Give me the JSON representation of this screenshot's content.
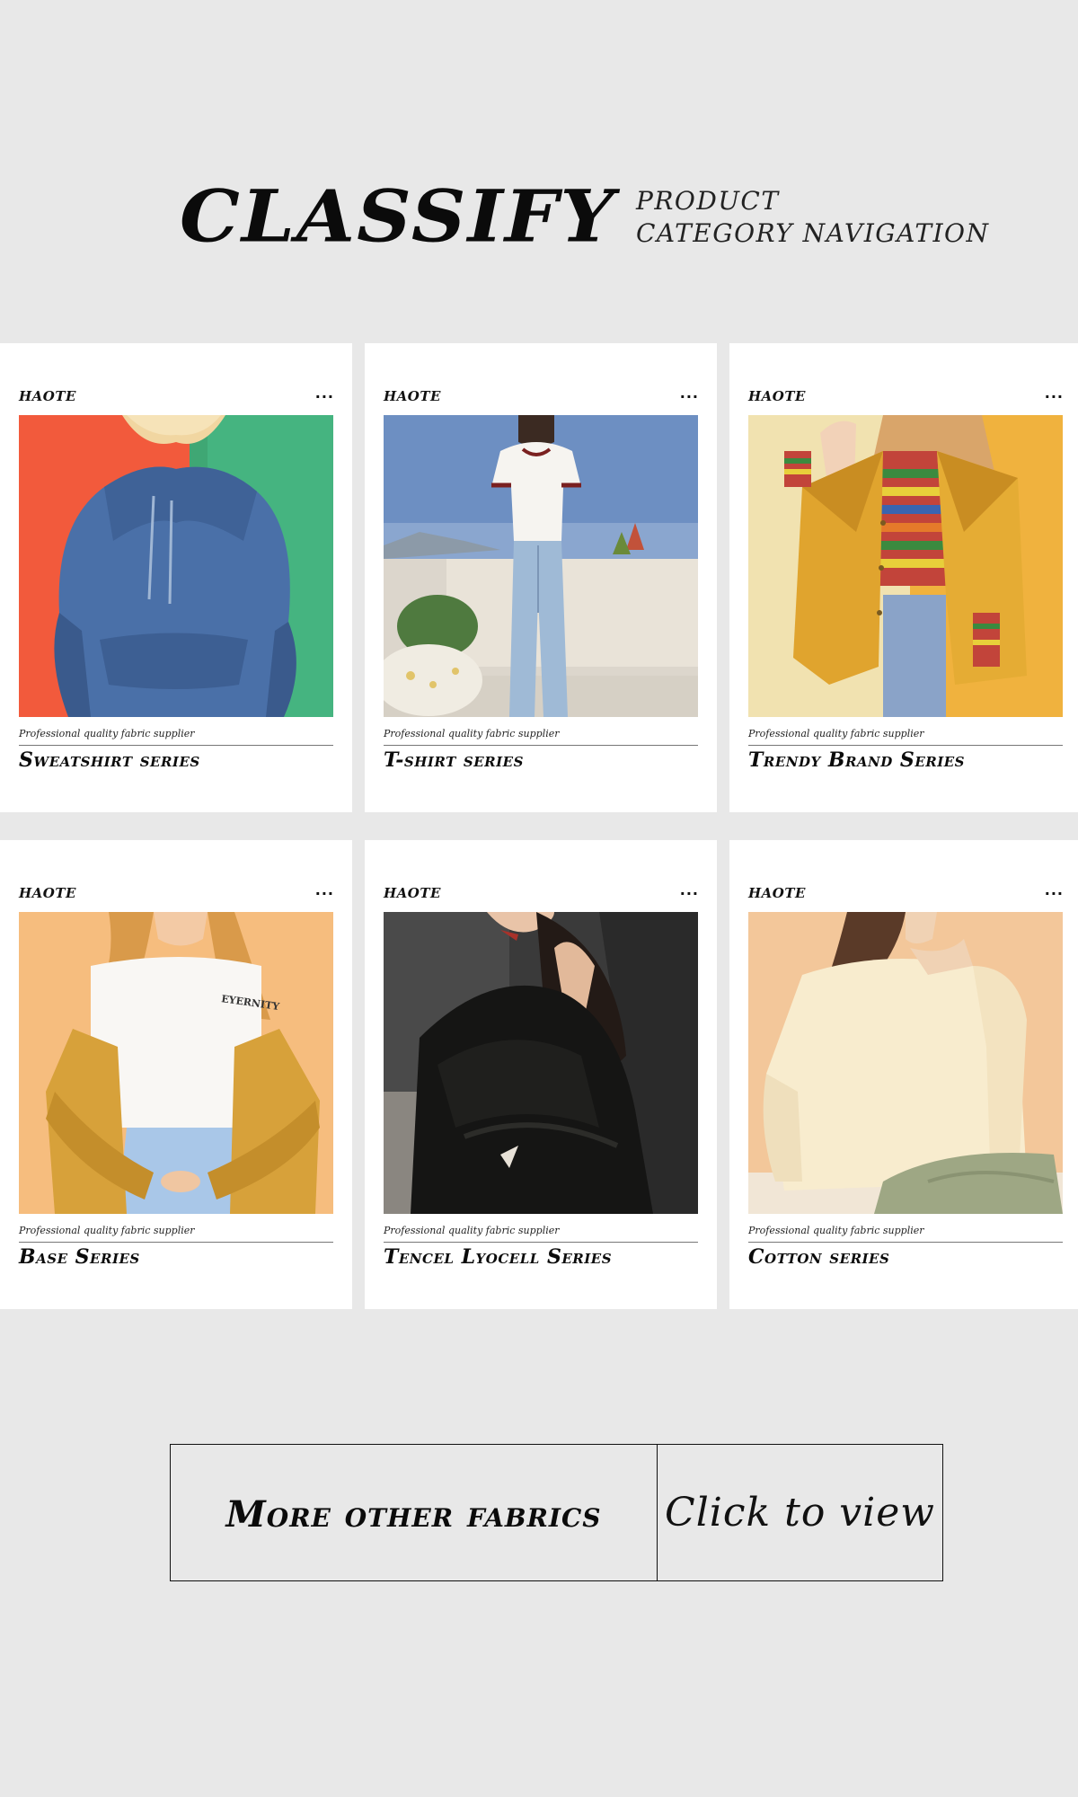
{
  "header": {
    "title": "CLASSIFY",
    "subtitle_line1": "PRODUCT",
    "subtitle_line2": "CATEGORY NAVIGATION"
  },
  "cards": [
    {
      "brand": "HAOTE",
      "more": "...",
      "tagline": "Professional quality fabric supplier",
      "title": "Sweatshirt series",
      "image": "photo-blue-hoodie"
    },
    {
      "brand": "HAOTE",
      "more": "...",
      "tagline": "Professional quality fabric supplier",
      "title": "T-shirt series",
      "image": "photo-white-tshirt-jeans"
    },
    {
      "brand": "HAOTE",
      "more": "...",
      "tagline": "Professional quality fabric supplier",
      "title": "Trendy Brand Series",
      "image": "photo-yellow-jacket-striped"
    },
    {
      "brand": "HAOTE",
      "more": "...",
      "tagline": "Professional quality fabric supplier",
      "title": "Base Series",
      "image": "photo-white-tee-mustard-jacket",
      "shirt_text": "EYERNITY"
    },
    {
      "brand": "HAOTE",
      "more": "...",
      "tagline": "Professional quality fabric supplier",
      "title": "Tencel Lyocell Series",
      "image": "photo-black-blouse"
    },
    {
      "brand": "HAOTE",
      "more": "...",
      "tagline": "Professional quality fabric supplier",
      "title": "Cotton series",
      "image": "photo-cream-sweater"
    }
  ],
  "cta": {
    "left_label": "More other fabrics",
    "right_label": "Click to view"
  }
}
